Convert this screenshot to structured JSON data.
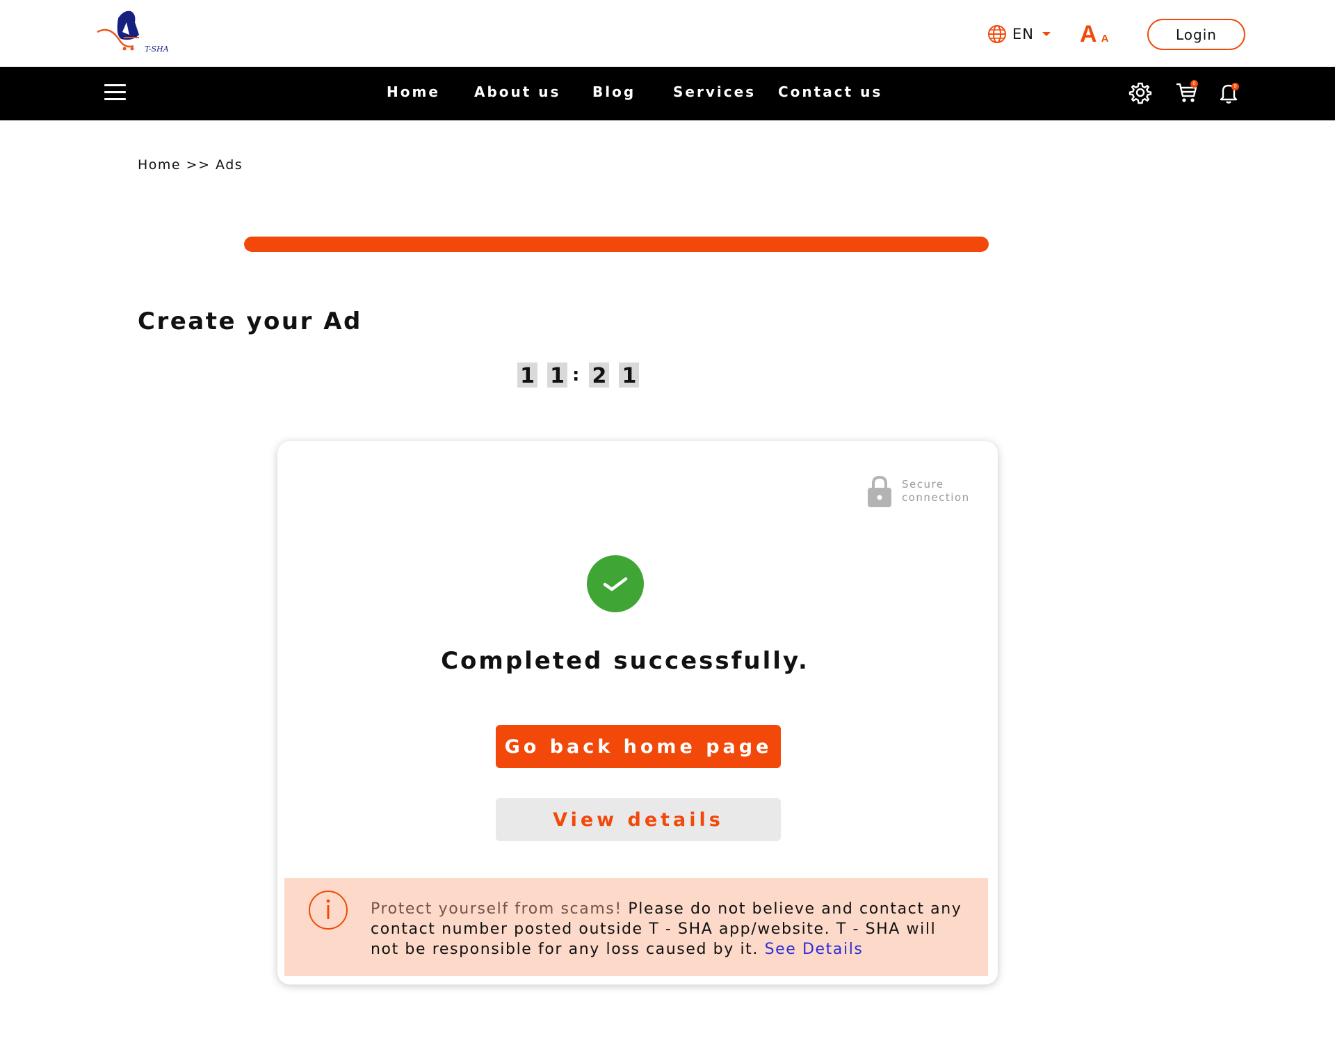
{
  "header": {
    "logo_text": "T-SHA",
    "language": "EN",
    "font_size_large": "A",
    "font_size_small": "A",
    "login_label": "Login"
  },
  "nav": {
    "links": [
      "Home",
      "About us",
      "Blog",
      "Services",
      "Contact us"
    ],
    "cart_count": "0",
    "notification_count": "0"
  },
  "breadcrumb": {
    "home": "Home",
    "separator": ">>",
    "current": "Ads"
  },
  "progress": {
    "percent": 100
  },
  "page": {
    "title": "Create your Ad"
  },
  "timer": {
    "digits": [
      "1",
      "1",
      "2",
      "1"
    ],
    "separator": ":"
  },
  "card": {
    "secure_line1": "Secure",
    "secure_line2": "connection",
    "success_message": "Completed successfully.",
    "primary_button": "Go back home page",
    "secondary_button": "View details",
    "warning": {
      "lead": "Protect yourself from scams!",
      "body": " Please do not believe and contact any contact number posted outside T - SHA app/website. T - SHA will not be responsible for any loss caused by it. ",
      "link": "See Details"
    }
  },
  "colors": {
    "accent": "#f2490a",
    "nav_background": "#000000",
    "success": "#3fa535",
    "warning_background": "#fcd9c8",
    "link": "#2b2ed6"
  }
}
